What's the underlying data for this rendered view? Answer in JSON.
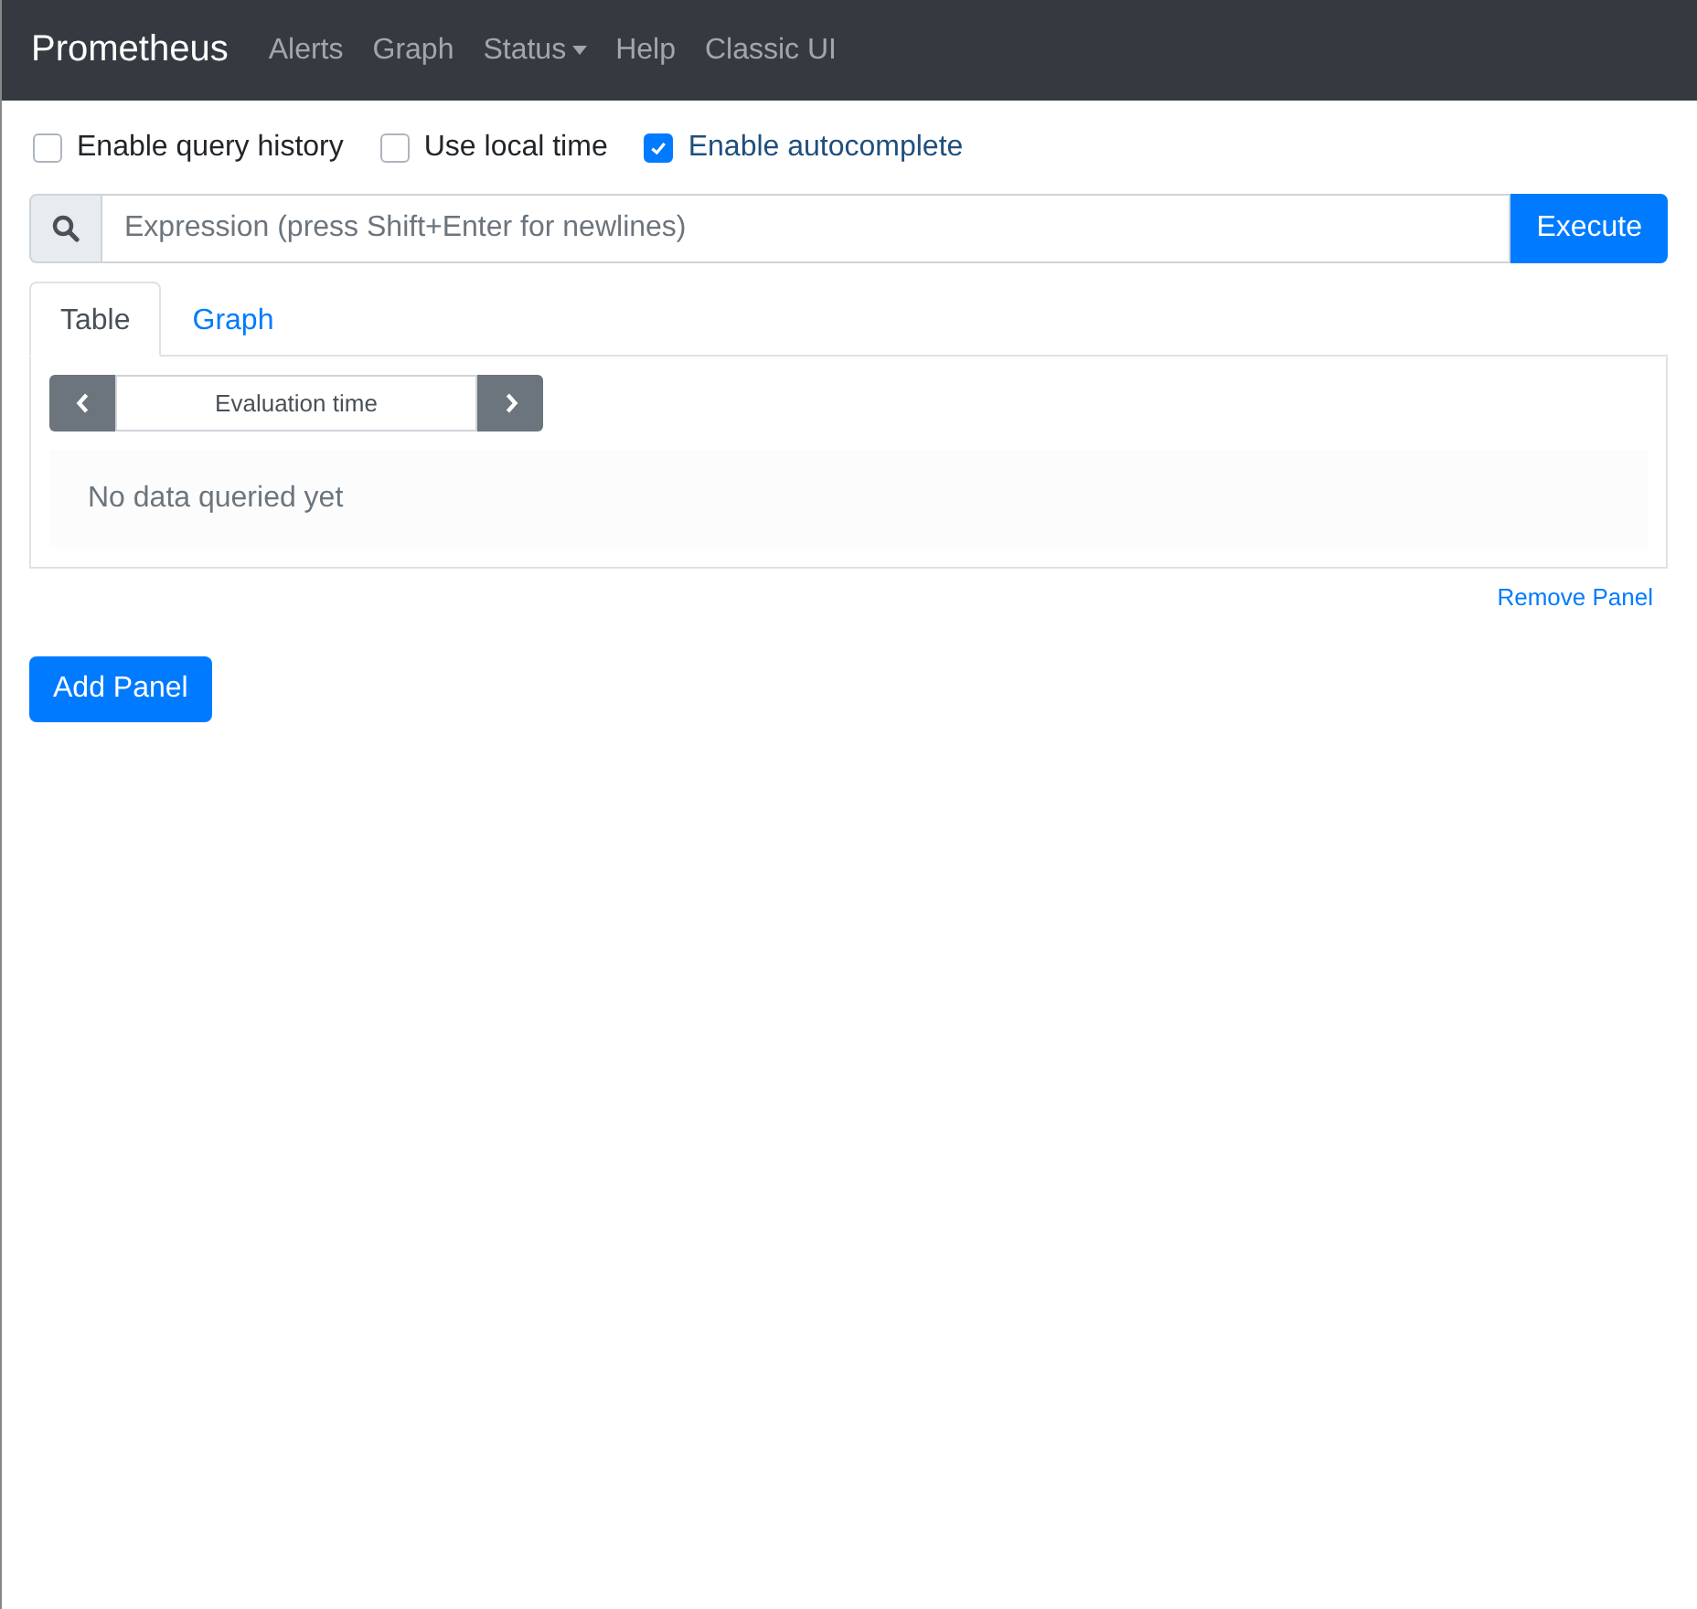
{
  "navbar": {
    "brand": "Prometheus",
    "items": [
      {
        "label": "Alerts",
        "dropdown": false
      },
      {
        "label": "Graph",
        "dropdown": false
      },
      {
        "label": "Status",
        "dropdown": true
      },
      {
        "label": "Help",
        "dropdown": false
      },
      {
        "label": "Classic UI",
        "dropdown": false
      }
    ]
  },
  "options": [
    {
      "label": "Enable query history",
      "checked": false
    },
    {
      "label": "Use local time",
      "checked": false
    },
    {
      "label": "Enable autocomplete",
      "checked": true
    }
  ],
  "query": {
    "placeholder": "Expression (press Shift+Enter for newlines)",
    "execute": "Execute"
  },
  "panel": {
    "tabs": [
      {
        "label": "Table",
        "selected": true
      },
      {
        "label": "Graph",
        "selected": false
      }
    ],
    "evaluation_time": {
      "placeholder": "Evaluation time"
    },
    "empty_message": "No data queried yet",
    "remove": "Remove Panel"
  },
  "add_panel": "Add Panel"
}
